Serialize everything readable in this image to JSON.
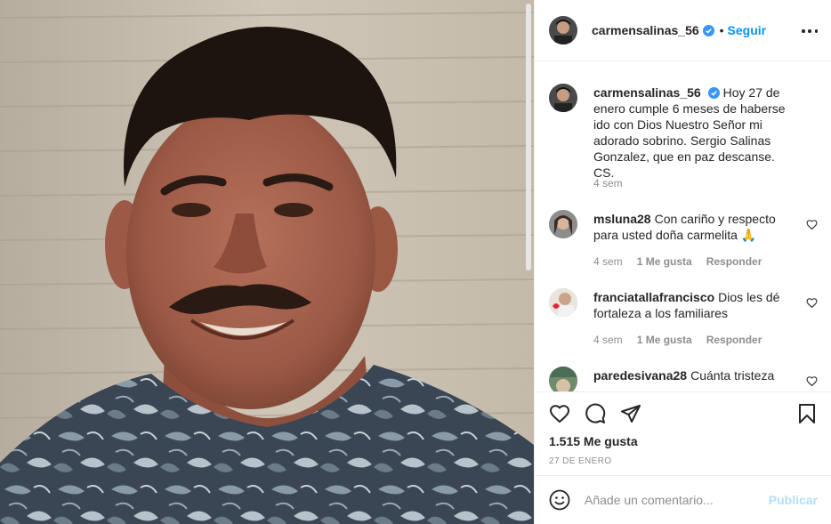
{
  "post": {
    "username": "carmensalinas_56",
    "follow_label": "Seguir",
    "separator": "•",
    "icons": {
      "verified": "verified-badge-icon",
      "more": "more-options-icon",
      "like": "heart-icon",
      "comment": "comment-icon",
      "share": "share-icon",
      "save": "bookmark-icon",
      "emoji": "emoji-icon"
    },
    "accent_color": "#0095f6",
    "verified_color": "#3897f0"
  },
  "caption": {
    "username": "carmensalinas_56",
    "text": "Hoy 27 de enero cumple 6 meses de haberse ido con Dios Nuestro Señor mi adorado sobrino. Sergio Salinas Gonzalez, que en paz descanse. CS.",
    "time": "4 sem"
  },
  "comments": [
    {
      "username": "msluna28",
      "text": "Con cariño y respecto para usted doña carmelita 🙏",
      "time": "4 sem",
      "likes": "1 Me gusta",
      "reply": "Responder"
    },
    {
      "username": "franciatallafrancisco",
      "text": "Dios les dé fortaleza a los familiares",
      "time": "4 sem",
      "likes": "1 Me gusta",
      "reply": "Responder"
    },
    {
      "username": "paredesivana28",
      "text": "Cuánta tristeza"
    }
  ],
  "actions": {
    "likes_count": "1.515 Me gusta",
    "date": "27 DE ENERO"
  },
  "add_comment": {
    "placeholder": "Añade un comentario...",
    "publish_label": "Publicar"
  }
}
